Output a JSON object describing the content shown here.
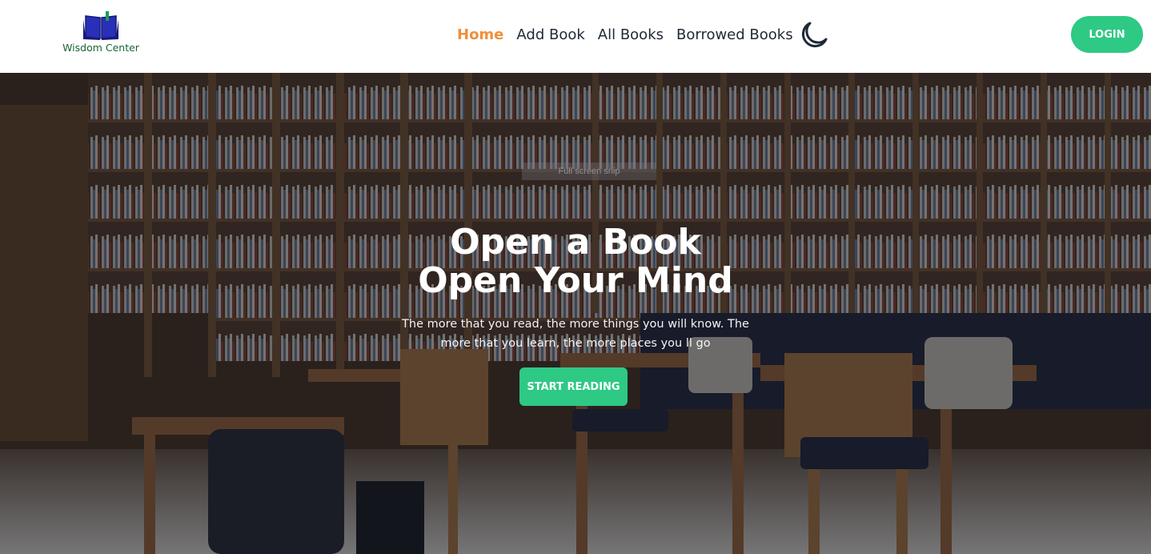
{
  "brand": {
    "name": "Wisdom Center",
    "logo_icon": "open-book-icon"
  },
  "nav": {
    "items": [
      {
        "label": "Home",
        "active": true
      },
      {
        "label": "Add Book",
        "active": false
      },
      {
        "label": "All Books",
        "active": false
      },
      {
        "label": "Borrowed Books",
        "active": false
      }
    ],
    "theme_toggle_icon": "moon-icon",
    "login_label": "LOGIN"
  },
  "hero": {
    "title_line1": "Open a Book",
    "title_line2": "Open Your Mind",
    "subtitle": "The more that you read, the more things you will know. The more that you learn, the more places you ll go",
    "cta_label": "START READING",
    "background": "library-bookshelves-photo"
  },
  "ghost_tooltip": "Full screen snip",
  "colors": {
    "accent": "#2ec985",
    "active_nav": "#f0903a",
    "nav_text": "#1f2937",
    "brand_text": "#166534",
    "logo_blue": "#1e22a8"
  }
}
